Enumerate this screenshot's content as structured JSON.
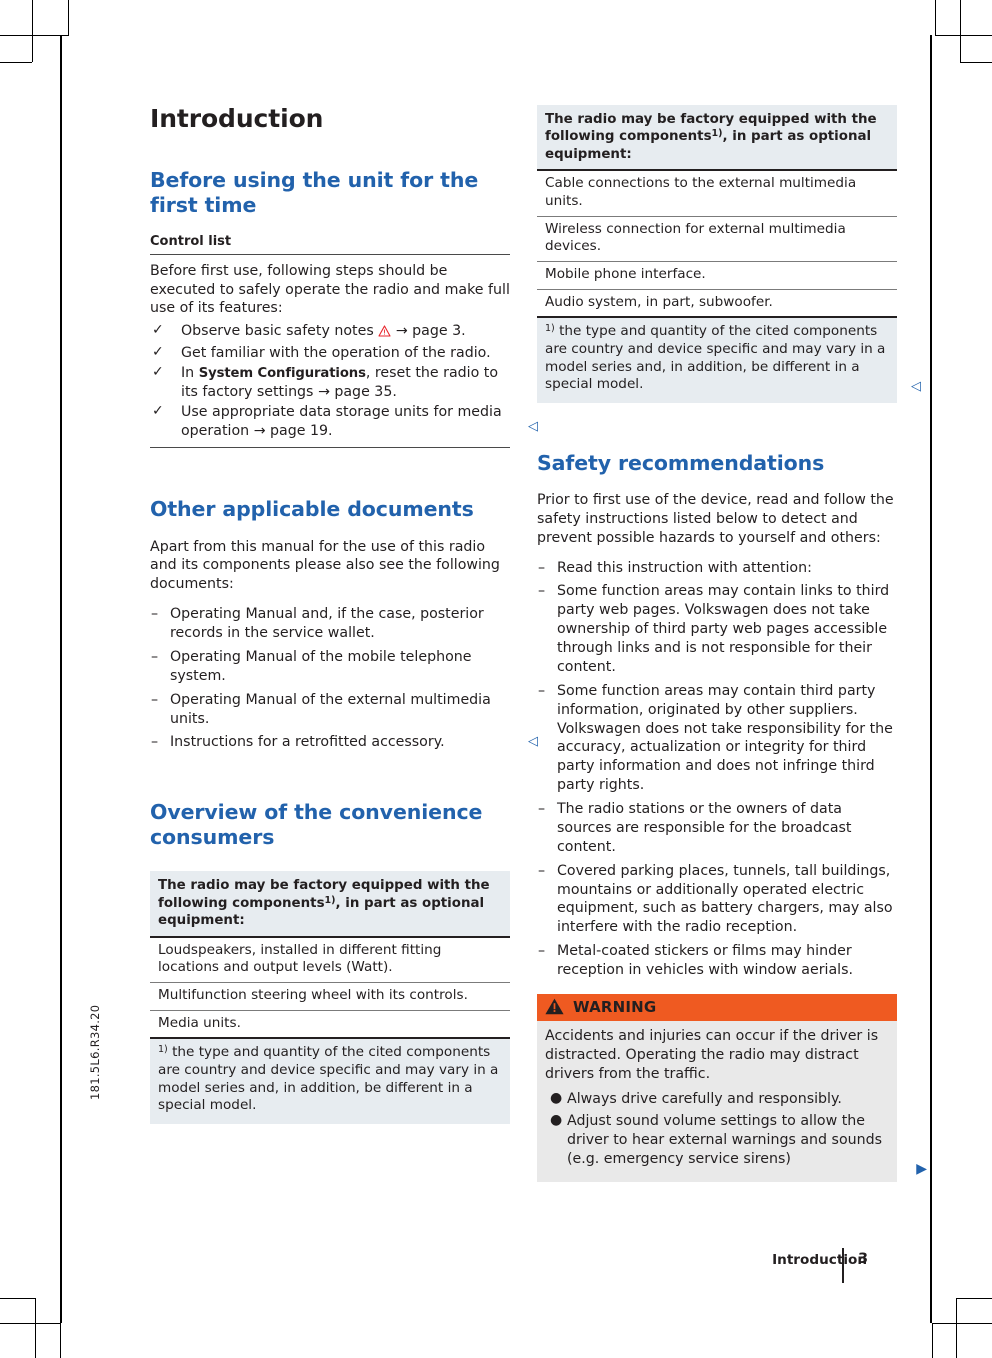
{
  "document": {
    "code": "181.5L6.R34.20",
    "footer_title": "Introduction",
    "page_number": "3",
    "accent_blue": "#2262ac",
    "warning_orange": "#ef5a21",
    "table_header_bg": "#e7ecf0",
    "warning_body_bg": "#e9e9e9"
  },
  "left_column": {
    "chapter_title": "Introduction",
    "section1": {
      "heading": "Before using the unit for the first time",
      "subheading": "Control list",
      "intro": "Before first use, following steps should be executed to safely operate the radio and make full use of its features:",
      "items": [
        {
          "mark": "✓",
          "text_before": "Observe basic safety notes ",
          "icon": "warning-triangle-icon",
          "text_after": " → page 3."
        },
        {
          "mark": "✓",
          "text_before": "Get familiar with the operation of the radio.",
          "icon": "",
          "text_after": ""
        },
        {
          "mark": "✓",
          "text_before": "In ",
          "bold": "System Configurations",
          "text_after": ", reset the radio to its factory settings → page 35."
        },
        {
          "mark": "✓",
          "text_before": "Use appropriate data storage units for media operation → page 19.",
          "icon": "",
          "text_after": ""
        }
      ],
      "end_mark": "◁"
    },
    "section2": {
      "heading": "Other applicable documents",
      "intro": "Apart from this manual for the use of this radio and its components please also see the following documents:",
      "items": [
        "Operating Manual and, if the case, posterior records in the service wallet.",
        "Operating Manual of the mobile telephone system.",
        "Operating Manual of the external multimedia units.",
        "Instructions for a retrofitted accessory."
      ],
      "dash": "–",
      "end_mark": "◁"
    },
    "section3": {
      "heading": "Overview of the convenience consumers",
      "table": {
        "header_before": "The radio may be factory equipped with the following components",
        "header_footnote": "1)",
        "header_after": ", in part as optional equipment:",
        "rows": [
          "Loudspeakers, installed in different fitting locations and output levels (Watt).",
          "Multifunction steering wheel with its controls.",
          "Media units."
        ],
        "footnote_marker": "1)",
        "footnote_text": " the type and quantity of the cited components are country and device specific and may vary in a model series and, in addition, be different in a special model."
      }
    }
  },
  "right_column": {
    "table": {
      "header_before": "The radio may be factory equipped with the following components",
      "header_footnote": "1)",
      "header_after": ", in part as optional equipment:",
      "rows": [
        "Cable connections to the external multimedia units.",
        "Wireless connection for external multimedia devices.",
        "Mobile phone interface.",
        "Audio system, in part, subwoofer."
      ],
      "footnote_marker": "1)",
      "footnote_text": " the type and quantity of the cited components are country and device specific and may vary in a model series and, in addition, be different in a special model.",
      "end_mark": "◁"
    },
    "section_safety": {
      "heading": "Safety recommendations",
      "intro": "Prior to first use of the device, read and follow the safety instructions listed below to detect and prevent possible hazards to yourself and others:",
      "dash": "–",
      "items": [
        "Read this instruction with attention:",
        "Some function areas may contain links to third party web pages. Volkswagen does not take ownership of third party web pages accessible through links and is not responsible for their content.",
        "Some function areas may contain third party information, originated by other suppliers. Volkswagen does not take responsibility for the accuracy, actualization or integrity for third party information and does not infringe third party rights.",
        "The radio stations or the owners of data sources are responsible for the broadcast content.",
        "Covered parking places, tunnels, tall buildings, mountains or additionally operated electric equipment, such as battery chargers, may also interfere with the radio reception.",
        "Metal-coated stickers or films may hinder reception in vehicles with window aerials."
      ]
    },
    "warning_box": {
      "label": "WARNING",
      "body": "Accidents and injuries can occur if the driver is distracted. Operating the radio may distract drivers from the traffic.",
      "bullet": "●",
      "bullets": [
        "Always drive carefully and responsibly.",
        "Adjust sound volume settings to allow the driver to hear external warnings and sounds (e.g. emergency service sirens)"
      ],
      "continue_mark": "▶"
    }
  }
}
